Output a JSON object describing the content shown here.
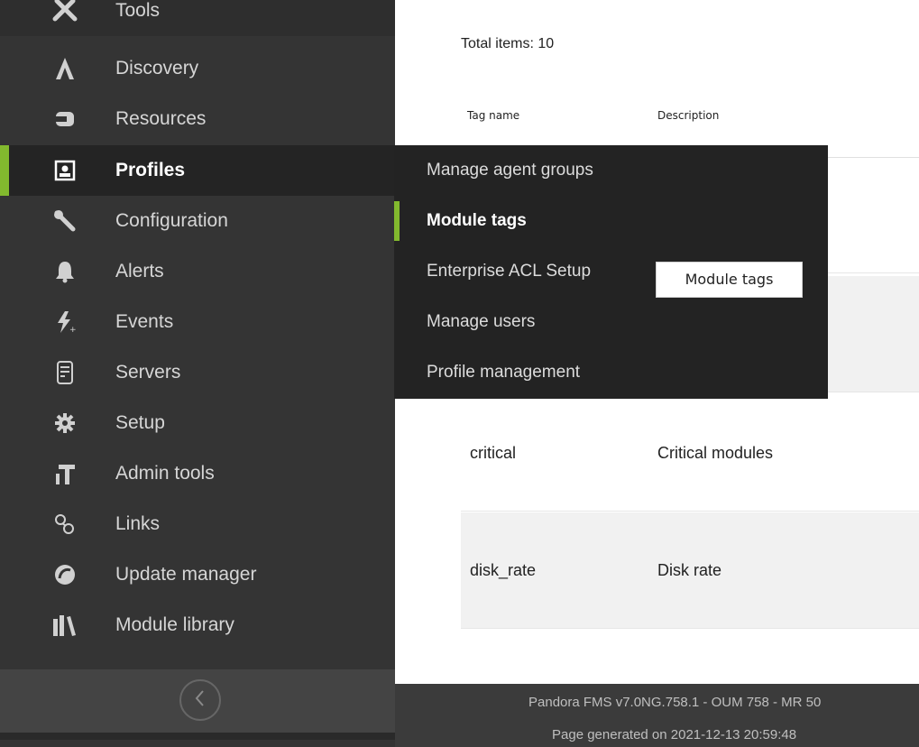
{
  "sidebar": {
    "items": [
      {
        "label": "Tools",
        "icon": "tools-icon"
      },
      {
        "label": "Discovery",
        "icon": "discovery-icon"
      },
      {
        "label": "Resources",
        "icon": "resources-icon"
      },
      {
        "label": "Profiles",
        "icon": "profiles-icon",
        "active": true
      },
      {
        "label": "Configuration",
        "icon": "wrench-icon"
      },
      {
        "label": "Alerts",
        "icon": "bell-icon"
      },
      {
        "label": "Events",
        "icon": "events-icon"
      },
      {
        "label": "Servers",
        "icon": "server-icon"
      },
      {
        "label": "Setup",
        "icon": "gear-icon"
      },
      {
        "label": "Admin tools",
        "icon": "admin-tools-icon"
      },
      {
        "label": "Links",
        "icon": "links-icon"
      },
      {
        "label": "Update manager",
        "icon": "update-manager-icon"
      },
      {
        "label": "Module library",
        "icon": "module-library-icon"
      }
    ],
    "collapse_icon": "chevron-left-circle-icon"
  },
  "flyout": {
    "items": [
      {
        "label": "Manage agent groups"
      },
      {
        "label": "Module tags",
        "active": true
      },
      {
        "label": "Enterprise ACL Setup"
      },
      {
        "label": "Manage users"
      },
      {
        "label": "Profile management"
      }
    ]
  },
  "tooltip": {
    "text": "Module tags"
  },
  "main": {
    "total_items": "Total items: 10",
    "table": {
      "headers": [
        "Tag name",
        "Description"
      ],
      "rows": [
        {
          "name": "critical",
          "description": "Critical modules"
        },
        {
          "name": "disk_rate",
          "description": "Disk rate"
        }
      ]
    }
  },
  "footer": {
    "line1": "Pandora FMS v7.0NG.758.1 - OUM 758 - MR 50",
    "line2": "Page generated on 2021-12-13 20:59:48"
  },
  "colors": {
    "accent": "#82b92e",
    "sidebar_bg": "#343434",
    "flyout_bg": "#232323"
  }
}
